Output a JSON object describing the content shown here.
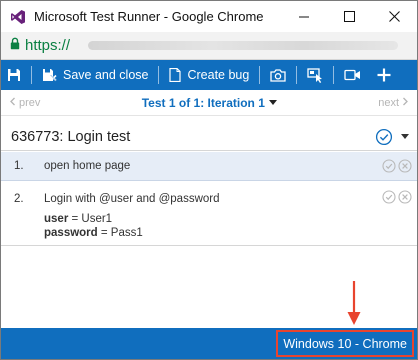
{
  "window": {
    "title": "Microsoft Test Runner - Google Chrome"
  },
  "address_bar": {
    "scheme": "https://"
  },
  "toolbar": {
    "save_and_close_label": "Save and close",
    "create_bug_label": "Create bug",
    "icons": [
      "save-icon",
      "save-and-close-icon",
      "create-bug-icon",
      "screenshot-icon",
      "capture-actions-icon",
      "record-video-icon",
      "add-icon"
    ]
  },
  "navigation": {
    "prev_label": "prev",
    "next_label": "next",
    "iteration_label": "Test 1 of 1: Iteration 1"
  },
  "test_case": {
    "title": "636773: Login test"
  },
  "steps": [
    {
      "number": "1.",
      "action": "open home page"
    },
    {
      "number": "2.",
      "action": "Login with @user and @password",
      "params": [
        {
          "name": "user",
          "equals": " = ",
          "value": "User1"
        },
        {
          "name": "password",
          "equals": " = ",
          "value": "Pass1"
        }
      ]
    }
  ],
  "status_bar": {
    "environment": "Windows 10 - Chrome"
  },
  "colors": {
    "accent": "#106ebe",
    "highlight": "#e8442e",
    "selected_row": "#e6edf7",
    "https_green": "#0b8043"
  }
}
